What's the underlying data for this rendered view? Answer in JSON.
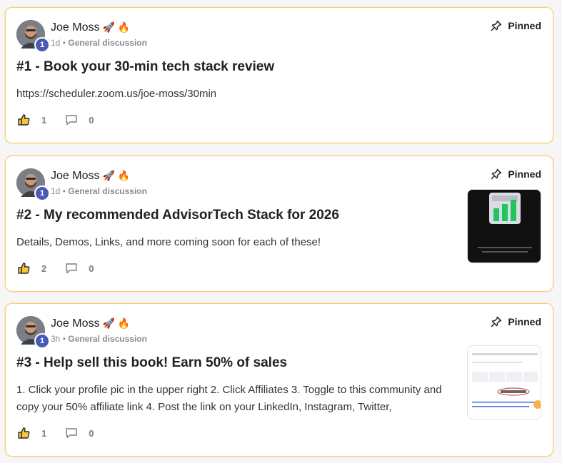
{
  "posts": [
    {
      "author": "Joe Moss",
      "author_emojis": "🚀 🔥",
      "level": "1",
      "time": "1d",
      "separator": "•",
      "category": "General discussion",
      "pinned_label": "Pinned",
      "title": "#1 - Book your 30-min tech stack review",
      "body": "https://scheduler.zoom.us/joe-moss/30min",
      "likes": "1",
      "comments": "0"
    },
    {
      "author": "Joe Moss",
      "author_emojis": "🚀 🔥",
      "level": "1",
      "time": "1d",
      "separator": "•",
      "category": "General discussion",
      "pinned_label": "Pinned",
      "title": "#2 - My recommended AdvisorTech Stack for 2026",
      "body": "Details, Demos, Links, and more coming soon for each of these!",
      "likes": "2",
      "comments": "0",
      "thumbnail_text": "The Ultimate AdvisorTech Stack for 2026"
    },
    {
      "author": "Joe Moss",
      "author_emojis": "🚀 🔥",
      "level": "1",
      "time": "3h",
      "separator": "•",
      "category": "General discussion",
      "pinned_label": "Pinned",
      "title": "#3 - Help sell this book! Earn 50% of sales",
      "body": "1. Click your profile pic in the upper right 2. Click Affiliates 3. Toggle to this community and copy your 50% affiliate link 4. Post the link on your LinkedIn, Instagram, Twitter,",
      "likes": "1",
      "comments": "0"
    }
  ],
  "icons": {
    "pin": "pin-icon",
    "like": "thumbs-up-icon",
    "comment": "comment-icon"
  },
  "colors": {
    "card_border": "#f5cf86",
    "level_badge": "#4a5bb5",
    "muted_text": "#8b8b8b"
  }
}
